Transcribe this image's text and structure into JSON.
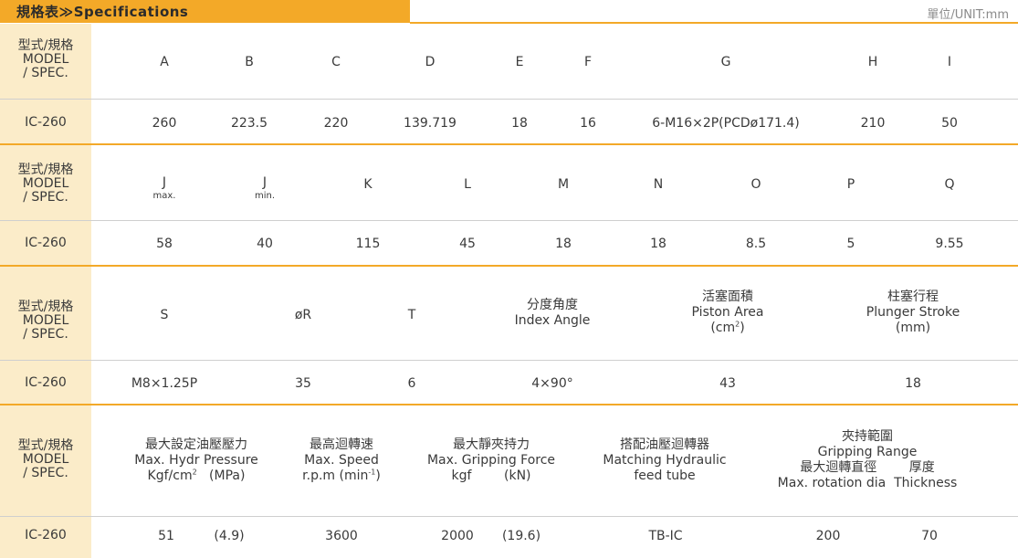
{
  "header": {
    "title": "規格表≫Specifications",
    "unit": "單位/UNIT:mm"
  },
  "label": {
    "line1": "型式/規格",
    "line2": "MODEL",
    "line3": "/ SPEC.",
    "model": "IC-260"
  },
  "table1": {
    "headers": [
      "A",
      "B",
      "C",
      "D",
      "E",
      "F",
      "G",
      "H",
      "I"
    ],
    "values": [
      "260",
      "223.5",
      "220",
      "139.719",
      "18",
      "16",
      "6-M16×2P(PCDø171.4)",
      "210",
      "50"
    ]
  },
  "table2": {
    "headers": [
      "J",
      "J",
      "K",
      "L",
      "M",
      "N",
      "O",
      "P",
      "Q"
    ],
    "subs": [
      "max.",
      "min."
    ],
    "values": [
      "58",
      "40",
      "115",
      "45",
      "18",
      "18",
      "8.5",
      "5",
      "9.55"
    ]
  },
  "table3": {
    "h_s": "S",
    "h_r": "øR",
    "h_t": "T",
    "h_index_zh": "分度角度",
    "h_index_en": "Index Angle",
    "h_piston_zh": "活塞面積",
    "h_piston_en": "Piston Area",
    "h_piston_unit": "(cm",
    "h_piston_sup": "2",
    "h_piston_close": ")",
    "h_plunger_zh": "柱塞行程",
    "h_plunger_en": "Plunger Stroke",
    "h_plunger_unit": "(mm)",
    "values": [
      "M8×1.25P",
      "35",
      "6",
      "4×90°",
      "43",
      "18"
    ]
  },
  "table4": {
    "h_press_zh": "最大設定油壓壓力",
    "h_press_en": "Max. Hydr Pressure",
    "h_press_unit1": "Kgf/cm",
    "h_press_sup": "2",
    "h_press_unit2": "(MPa)",
    "h_speed_zh": "最高迴轉速",
    "h_speed_en": "Max. Speed",
    "h_speed_unit1": "r.p.m (min",
    "h_speed_sup": "-1",
    "h_speed_unit2": ")",
    "h_grip_zh": "最大靜夾持力",
    "h_grip_en": "Max. Gripping Force",
    "h_grip_unit1": "kgf",
    "h_grip_unit2": "(kN)",
    "h_tube_zh": "搭配油壓迴轉器",
    "h_tube_en1": "Matching Hydraulic",
    "h_tube_en2": "feed tube",
    "h_range_zh": "夾持範圍",
    "h_range_en": "Gripping Range",
    "h_rot_zh": "最大迴轉直徑",
    "h_thick_zh": "厚度",
    "h_rot_en": "Max. rotation dia",
    "h_thick_en": "Thickness",
    "values": [
      "51",
      "(4.9)",
      "3600",
      "2000",
      "(19.6)",
      "TB-IC",
      "200",
      "70"
    ]
  }
}
